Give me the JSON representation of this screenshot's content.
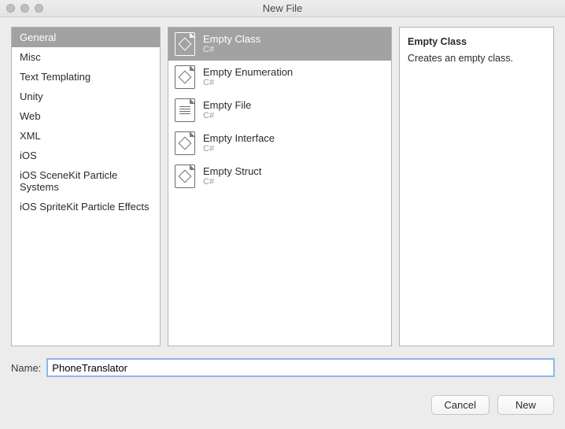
{
  "window": {
    "title": "New File"
  },
  "sidebar": {
    "items": [
      {
        "label": "General",
        "selected": true
      },
      {
        "label": "Misc"
      },
      {
        "label": "Text Templating"
      },
      {
        "label": "Unity"
      },
      {
        "label": "Web"
      },
      {
        "label": "XML"
      },
      {
        "label": "iOS"
      },
      {
        "label": "iOS SceneKit Particle Systems"
      },
      {
        "label": "iOS SpriteKit Particle Effects"
      }
    ]
  },
  "templates": {
    "items": [
      {
        "name": "Empty Class",
        "lang": "C#",
        "icon": "class",
        "selected": true
      },
      {
        "name": "Empty Enumeration",
        "lang": "C#",
        "icon": "class"
      },
      {
        "name": "Empty File",
        "lang": "C#",
        "icon": "file"
      },
      {
        "name": "Empty Interface",
        "lang": "C#",
        "icon": "class"
      },
      {
        "name": "Empty Struct",
        "lang": "C#",
        "icon": "class"
      }
    ]
  },
  "details": {
    "title": "Empty Class",
    "description": "Creates an empty class."
  },
  "nameField": {
    "label": "Name:",
    "value": "PhoneTranslator"
  },
  "buttons": {
    "cancel": "Cancel",
    "new": "New"
  }
}
